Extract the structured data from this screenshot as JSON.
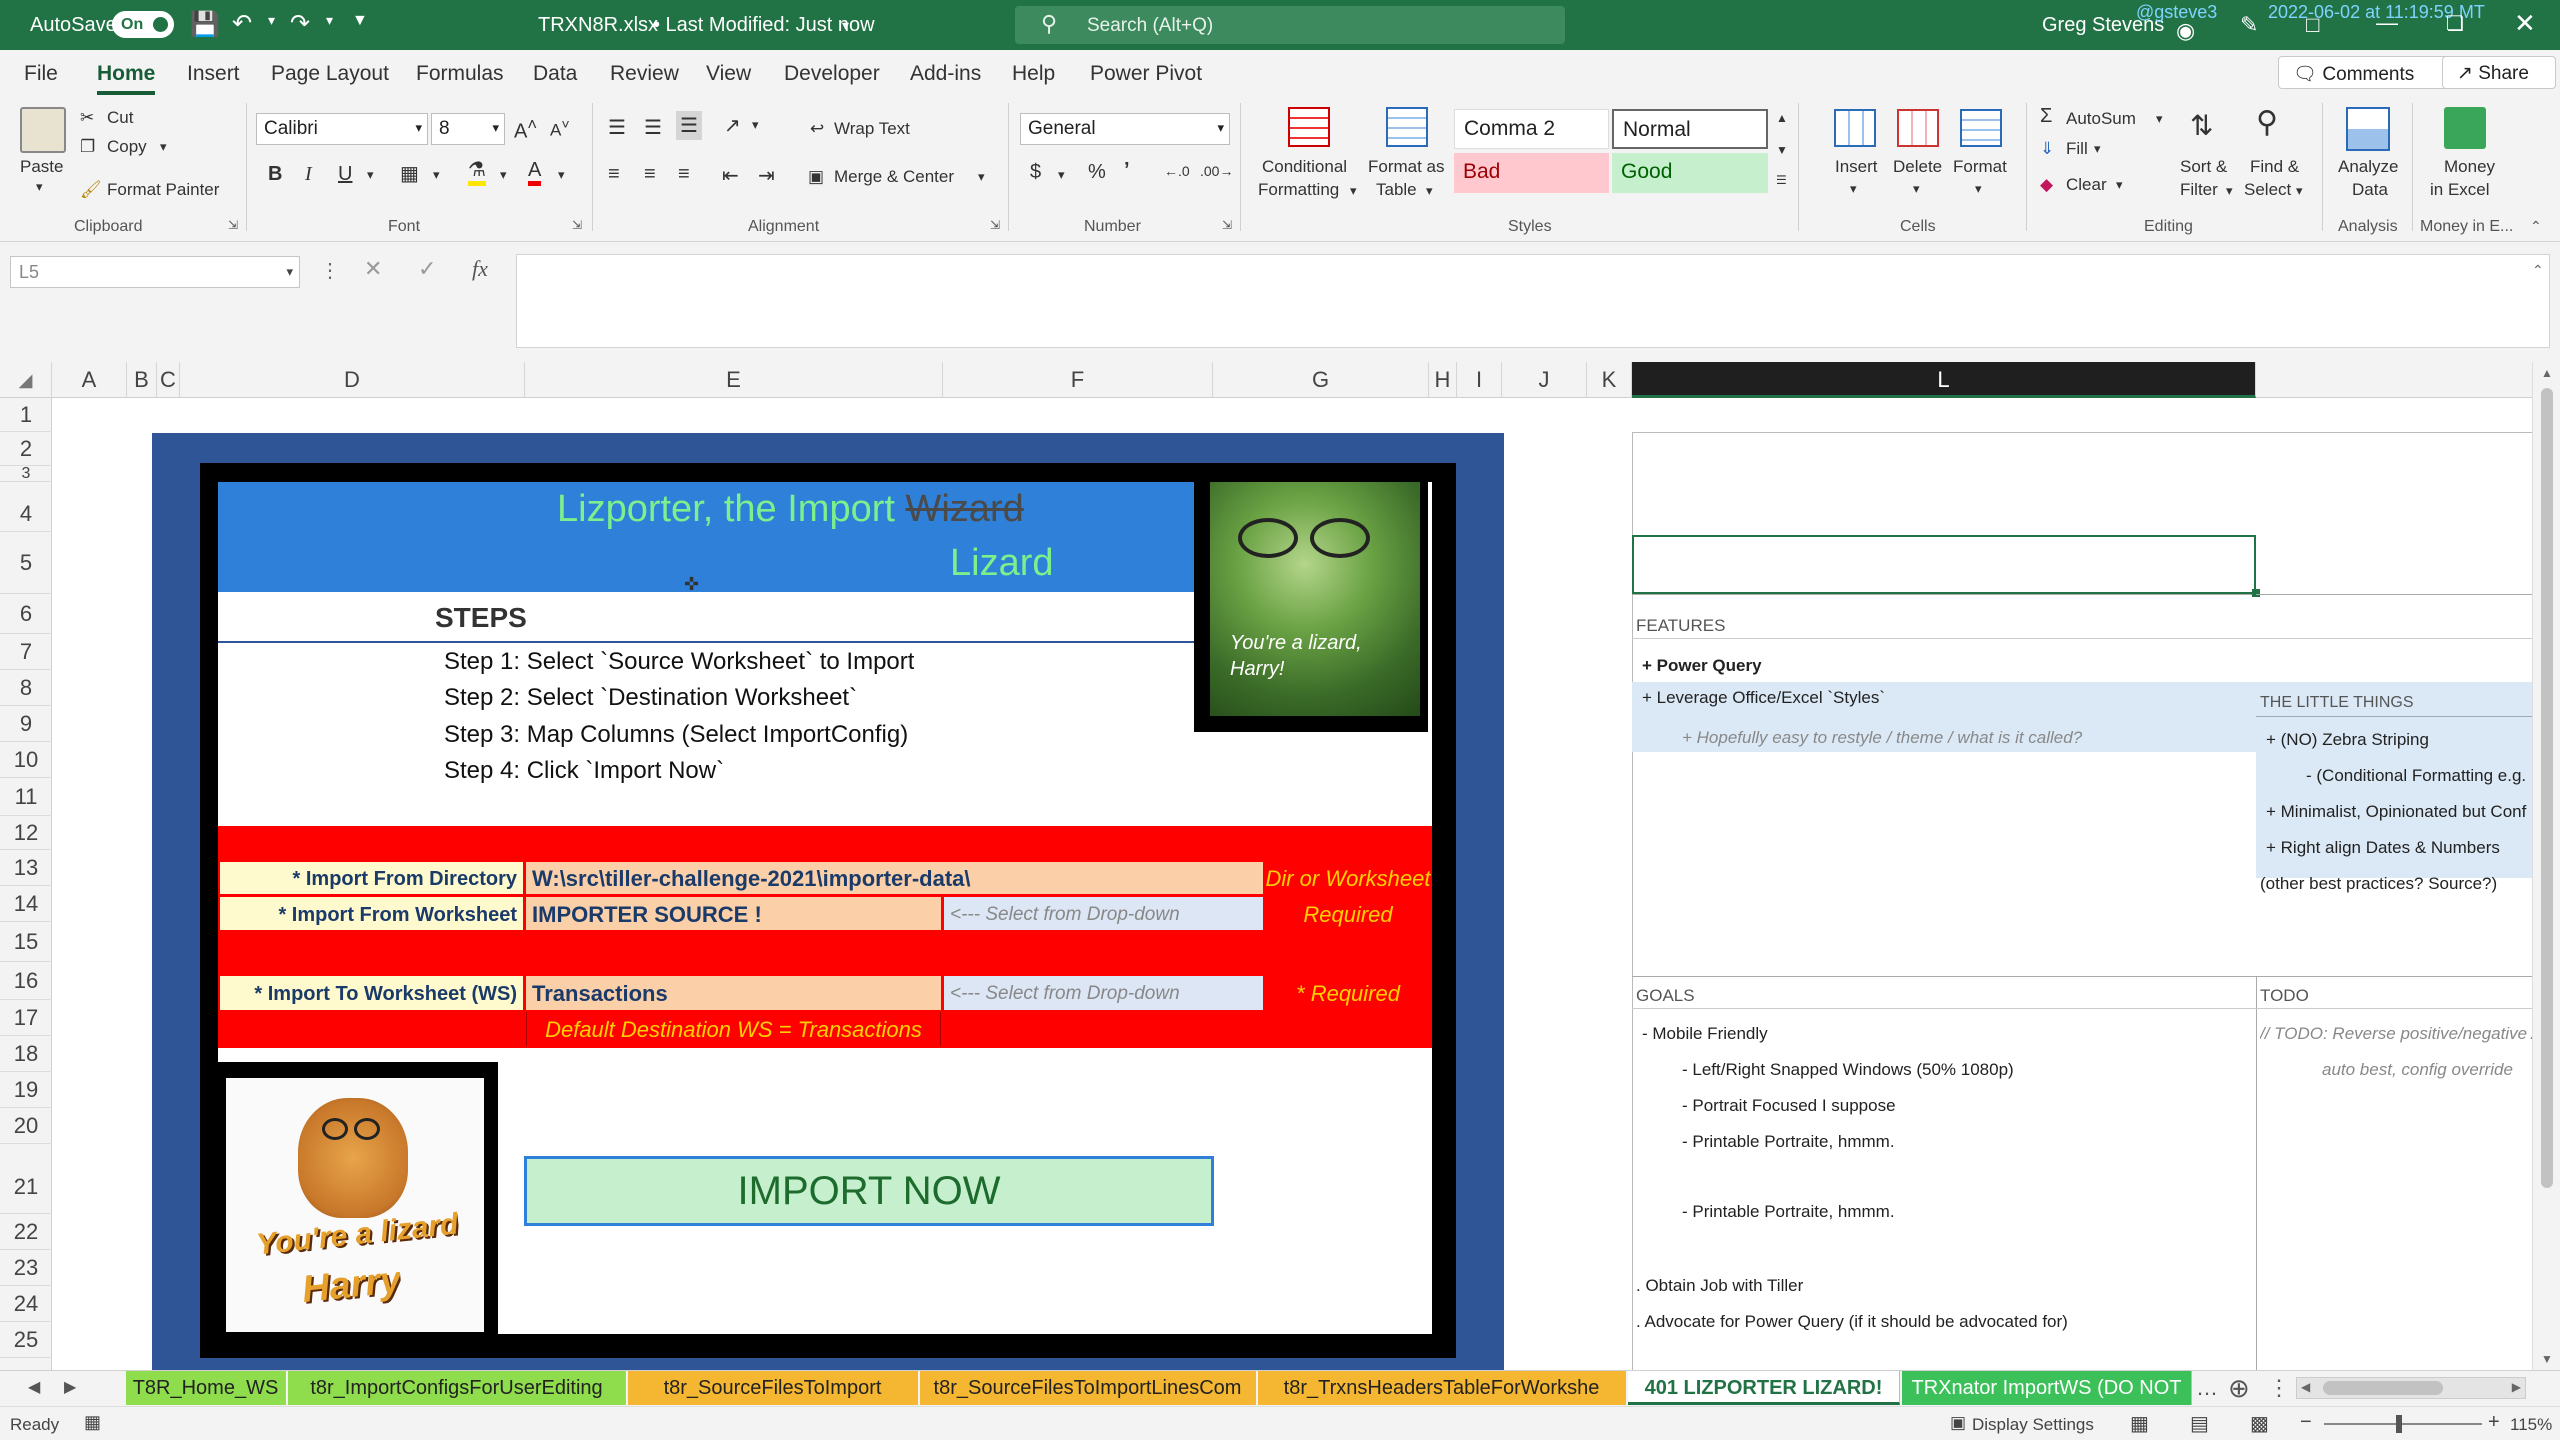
{
  "titlebar": {
    "autosave_label": "AutoSave",
    "autosave_state": "On",
    "filename": "TRXN8R.xlsx",
    "modified": "• Last Modified: Just now",
    "search_placeholder": "Search (Alt+Q)",
    "user": "Greg Stevens",
    "overlay_user": "@gsteve3",
    "overlay_time": "2022-06-02 at 11:19:59 MT"
  },
  "menu": {
    "items": [
      "File",
      "Home",
      "Insert",
      "Page Layout",
      "Formulas",
      "Data",
      "Review",
      "View",
      "Developer",
      "Add-ins",
      "Help",
      "Power Pivot"
    ],
    "comments": "Comments",
    "share": "Share"
  },
  "ribbon": {
    "paste": "Paste",
    "cut": "Cut",
    "copy": "Copy",
    "format_painter": "Format Painter",
    "clipboard": "Clipboard",
    "font_name": "Calibri",
    "font_size": "8",
    "font": "Font",
    "bold": "B",
    "italic": "I",
    "underline": "U",
    "alignment": "Alignment",
    "wrap_text": "Wrap Text",
    "merge_center": "Merge & Center",
    "number_format": "General",
    "number": "Number",
    "conditional_formatting_1": "Conditional",
    "conditional_formatting_2": "Formatting",
    "format_as_table_1": "Format as",
    "format_as_table_2": "Table",
    "style_comma2": "Comma 2",
    "style_normal": "Normal",
    "style_bad": "Bad",
    "style_good": "Good",
    "styles": "Styles",
    "insert": "Insert",
    "delete": "Delete",
    "format": "Format",
    "cells": "Cells",
    "autosum": "AutoSum",
    "fill": "Fill",
    "clear": "Clear",
    "sort_filter_1": "Sort &",
    "sort_filter_2": "Filter",
    "find_select_1": "Find &",
    "find_select_2": "Select",
    "editing": "Editing",
    "analyze_1": "Analyze",
    "analyze_2": "Data",
    "analysis": "Analysis",
    "money_1": "Money",
    "money_2": "in Excel",
    "money_group": "Money in E..."
  },
  "formula_bar": {
    "name_box": "L5",
    "fx": "fx"
  },
  "columns": [
    "A",
    "B",
    "C",
    "D",
    "E",
    "F",
    "G",
    "H",
    "I",
    "J",
    "K",
    "L"
  ],
  "rows": [
    "1",
    "2",
    "3",
    "4",
    "5",
    "6",
    "7",
    "8",
    "9",
    "10",
    "11",
    "12",
    "13",
    "14",
    "15",
    "16",
    "17",
    "18",
    "19",
    "20",
    "21",
    "22",
    "23",
    "24",
    "25"
  ],
  "wizard": {
    "title_line": "Lizporter, the Import",
    "title_struck": "Wizard",
    "title_line2": "Lizard",
    "steps_header": "STEPS",
    "step1": "Step 1: Select `Source Worksheet` to Import",
    "step2": "Step 2: Select `Destination Worksheet`",
    "step3": "Step 3: Map Columns (Select ImportConfig)",
    "step4": "Step 4: Click `Import Now`",
    "import_dir_label": "* Import From Directory",
    "import_dir_value": "W:\\src\\tiller-challenge-2021\\importer-data\\",
    "import_dir_note": "Dir or Worksheet",
    "import_ws_label": "* Import From Worksheet",
    "import_ws_value": "IMPORTER SOURCE !",
    "import_ws_hint": "<--- Select from Drop-down",
    "import_ws_note": "Required",
    "dest_label": "* Import To Worksheet (WS)",
    "dest_value": "Transactions",
    "dest_hint": "<--- Select from Drop-down",
    "dest_note": "* Required",
    "default_dest": "Default Destination WS = Transactions",
    "import_button": "IMPORT NOW",
    "photo_caption_1": "You're a lizard,",
    "photo_caption_2": "Harry!",
    "sticker_1": "You're a lizard",
    "sticker_2": "Harry"
  },
  "notes": {
    "features_header": "FEATURES",
    "f1": "+ Power Query",
    "f2": "+ Leverage Office/Excel `Styles`",
    "f3": "+ Hopefully easy to restyle / theme / what is it called?",
    "little_header": "THE LITTLE THINGS",
    "lt1": "+ (NO) Zebra Striping",
    "lt2": "- (Conditional Formatting e.g.",
    "lt3": "+ Minimalist, Opinionated but Conf",
    "lt4": "+ Right align Dates & Numbers",
    "lt5": "(other best practices? Source?)",
    "goals_header": "GOALS",
    "g1": "- Mobile Friendly",
    "g2": "- Left/Right Snapped Windows (50% 1080p)",
    "g3": "- Portrait Focused I suppose",
    "g4": "- Printable Portraite, hmmm.",
    "g5": "- Printable Portraite, hmmm.",
    "g6": ". Obtain Job with Tiller",
    "g7": ". Advocate for Power Query (if it should be advocated for)",
    "todo_header": "TODO",
    "t1": "// TODO: Reverse positive/negative A",
    "t2": "auto best, config override"
  },
  "tabs": [
    {
      "label": "T8R_Home_WS",
      "color": "#8fdc4c"
    },
    {
      "label": "t8r_ImportConfigsForUserEditing",
      "color": "#8fdc4c"
    },
    {
      "label": "t8r_SourceFilesToImport",
      "color": "#f5b731"
    },
    {
      "label": "t8r_SourceFilesToImportLinesCom",
      "color": "#f5b731"
    },
    {
      "label": "t8r_TrxnsHeadersTableForWorkshe",
      "color": "#f5b731"
    },
    {
      "label": "401 LIZPORTER LIZARD!",
      "color": "#ffffff"
    },
    {
      "label": "TRXnator ImportWS (DO NOT",
      "color": "#3cc15a"
    }
  ],
  "status": {
    "ready": "Ready",
    "display_settings": "Display Settings",
    "zoom": "115%"
  }
}
